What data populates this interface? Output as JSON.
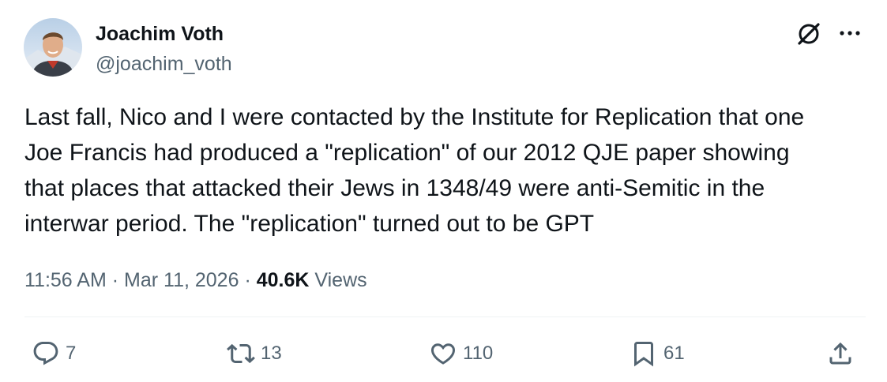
{
  "author": {
    "name": "Joachim Voth",
    "handle": "@joachim_voth"
  },
  "tweet": {
    "lines": [
      "Last fall, Nico and I were contacted by the Institute for Replication that one",
      "Joe Francis had produced a \"replication\" of our 2012 QJE paper showing",
      "that places that attacked their Jews in 1348/49 were anti-Semitic in the",
      "interwar period. The \"replication\" turned out to be GPT"
    ]
  },
  "meta": {
    "time": "11:56 AM",
    "separator": "·",
    "date": "Mar 11, 2026",
    "views_count": "40.6K",
    "views_label": "Views"
  },
  "actions": {
    "replies": "7",
    "reposts": "13",
    "likes": "110",
    "bookmarks": "61"
  },
  "icons": {
    "grok": "grok-icon",
    "more": "more-icon",
    "reply": "reply-icon",
    "repost": "repost-icon",
    "like": "heart-icon",
    "bookmark": "bookmark-icon",
    "share": "share-icon"
  },
  "colors": {
    "primary_text": "#0f1419",
    "secondary_text": "#536471",
    "divider": "#eff3f4"
  }
}
